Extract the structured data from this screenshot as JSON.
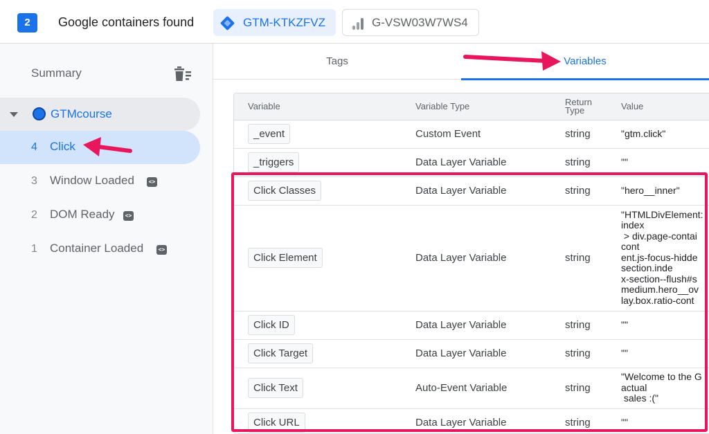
{
  "header": {
    "count": "2",
    "found_label": "Google containers found",
    "containers": [
      {
        "id": "GTM-KTKZFVZ",
        "icon": "gtm-diamond-icon",
        "active": true
      },
      {
        "id": "G-VSW03W7WS4",
        "icon": "analytics-bars-icon",
        "active": false
      }
    ]
  },
  "sidebar": {
    "summary_label": "Summary",
    "container_name": "GTMcourse",
    "events": [
      {
        "num": "4",
        "name": "Click",
        "selected": true,
        "has_code_icon": false
      },
      {
        "num": "3",
        "name": "Window Loaded",
        "selected": false,
        "has_code_icon": true
      },
      {
        "num": "2",
        "name": "DOM Ready",
        "selected": false,
        "has_code_icon": true
      },
      {
        "num": "1",
        "name": "Container Loaded",
        "selected": false,
        "has_code_icon": true
      }
    ]
  },
  "tabs": [
    {
      "label": "Tags",
      "active": false
    },
    {
      "label": "Variables",
      "active": true
    }
  ],
  "table": {
    "headers": [
      "Variable",
      "Variable Type",
      "Return Type",
      "Value"
    ],
    "rows": [
      {
        "variable": "_event",
        "type": "Custom Event",
        "return": "string",
        "value": "\"gtm.click\""
      },
      {
        "variable": "_triggers",
        "type": "Data Layer Variable",
        "return": "string",
        "value": "\"\""
      },
      {
        "variable": "Click Classes",
        "type": "Data Layer Variable",
        "return": "string",
        "value": "\"hero__inner\""
      },
      {
        "variable": "Click Element",
        "type": "Data Layer Variable",
        "return": "string",
        "value": "\"HTMLDivElement:\nindex\n > div.page-contai\ncont\nent.js-focus-hidde\nsection.inde\nx-section--flush#s\nmedium.hero__ov\nlay.box.ratio-cont"
      },
      {
        "variable": "Click ID",
        "type": "Data Layer Variable",
        "return": "string",
        "value": "\"\""
      },
      {
        "variable": "Click Target",
        "type": "Data Layer Variable",
        "return": "string",
        "value": "\"\""
      },
      {
        "variable": "Click Text",
        "type": "Auto-Event Variable",
        "return": "string",
        "value": "\"Welcome to the G\nactual\n sales :(\""
      },
      {
        "variable": "Click URL",
        "type": "Data Layer Variable",
        "return": "string",
        "value": "\"\""
      }
    ]
  },
  "colors": {
    "accent": "#1a73e8",
    "annotation": "#e8175d",
    "selected_bg": "#d2e3fc"
  }
}
